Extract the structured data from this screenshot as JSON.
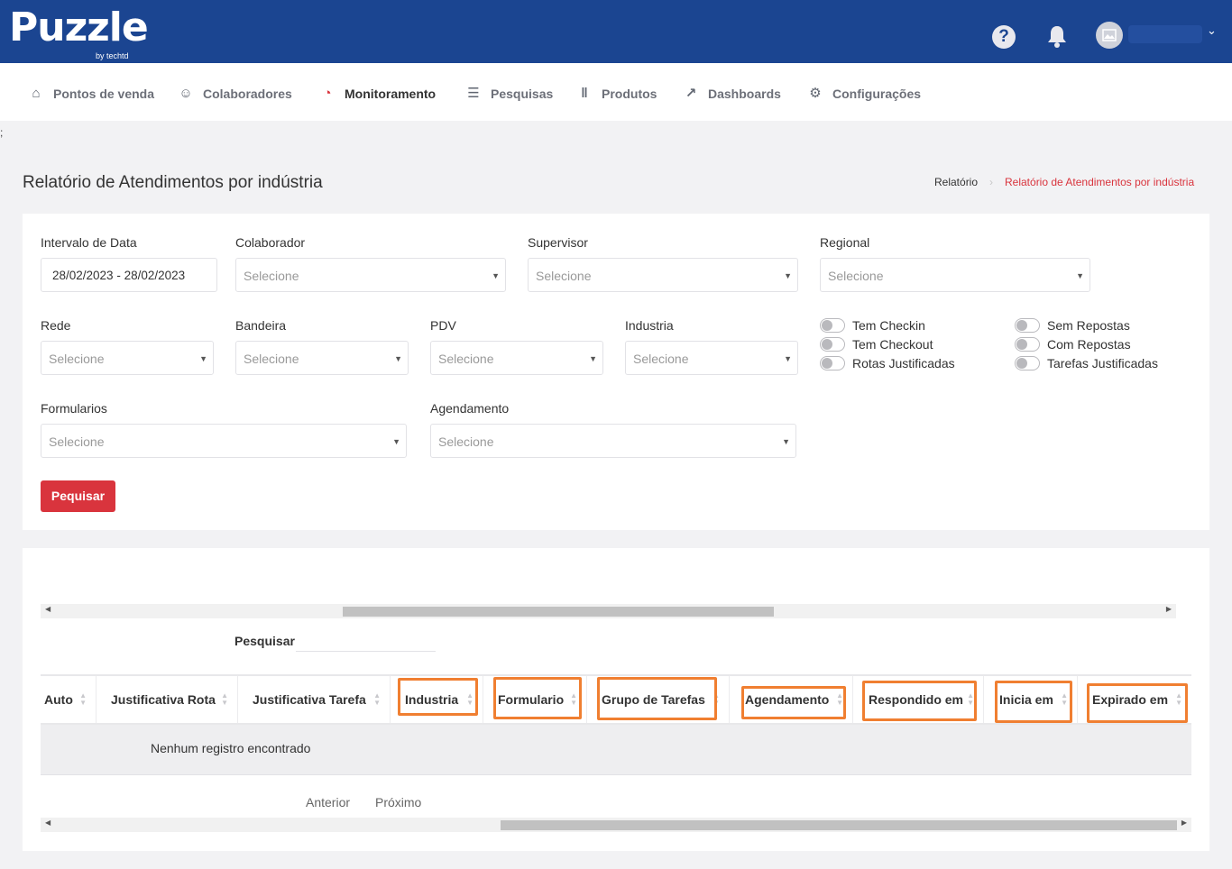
{
  "brand": {
    "name": "Puzzle",
    "sub": "by techtd"
  },
  "topbar": {
    "help_label": "?"
  },
  "nav": [
    {
      "label": "Pontos de venda",
      "icon": "store-icon"
    },
    {
      "label": "Colaboradores",
      "icon": "users-icon"
    },
    {
      "label": "Monitoramento",
      "icon": "monitor-icon"
    },
    {
      "label": "Pesquisas",
      "icon": "survey-icon"
    },
    {
      "label": "Produtos",
      "icon": "barcode-icon"
    },
    {
      "label": "Dashboards",
      "icon": "chart-line-icon"
    },
    {
      "label": "Configurações",
      "icon": "gears-icon"
    }
  ],
  "stray_char": ";",
  "page": {
    "title": "Relatório de Atendimentos por indústria",
    "breadcrumb": [
      "Relatório",
      "Relatório de Atendimentos por indústria"
    ]
  },
  "filters": {
    "date_label": "Intervalo de Data",
    "date_value": "28/02/2023 - 28/02/2023",
    "colaborador_label": "Colaborador",
    "supervisor_label": "Supervisor",
    "regional_label": "Regional",
    "rede_label": "Rede",
    "bandeira_label": "Bandeira",
    "pdv_label": "PDV",
    "industria_label": "Industria",
    "formularios_label": "Formularios",
    "agendamento_label": "Agendamento",
    "placeholder": "Selecione",
    "toggles": [
      "Tem Checkin",
      "Tem Checkout",
      "Rotas Justificadas",
      "Sem Repostas",
      "Com Repostas",
      "Tarefas Justificadas"
    ],
    "search_button": "Pequisar"
  },
  "table": {
    "search_label": "Pesquisar",
    "columns": [
      "Auto",
      "Justificativa Rota",
      "Justificativa Tarefa",
      "Industria",
      "Formulario",
      "Grupo de Tarefas",
      "Agendamento",
      "Respondido em",
      "Inicia em",
      "Expirado em"
    ],
    "empty_message": "Nenhum registro encontrado",
    "prev_label": "Anterior",
    "next_label": "Próximo"
  }
}
